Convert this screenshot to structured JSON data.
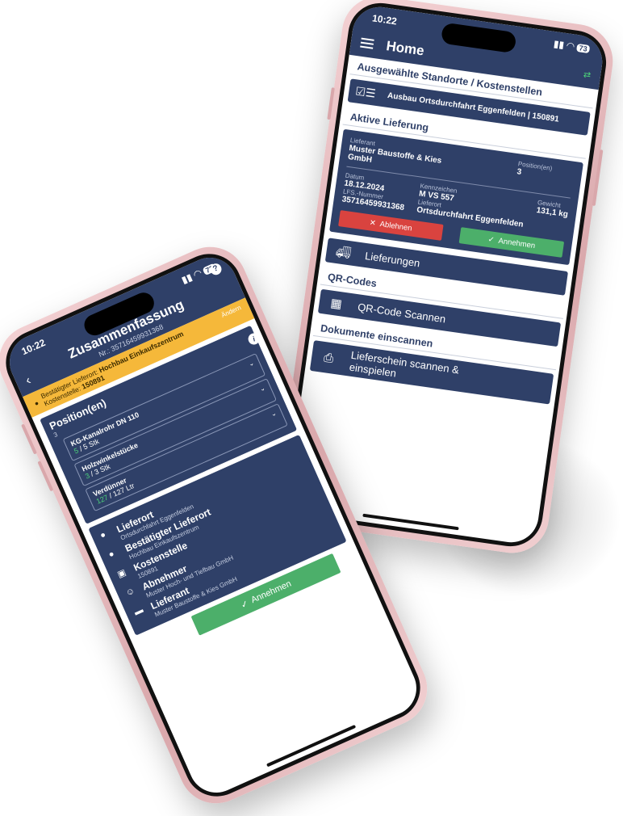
{
  "right_phone": {
    "status": {
      "time": "10:22",
      "battery": "73"
    },
    "appbar": {
      "title": "Home"
    },
    "sections": {
      "standorte": "Ausgewählte Standorte / Kostenstellen",
      "aktive": "Aktive Lieferung",
      "qr": "QR-Codes",
      "dokumente": "Dokumente einscannen"
    },
    "standort_item": "Ausbau Ortsdurchfahrt Eggenfelden | 150891",
    "delivery": {
      "lieferant_label": "Lieferant",
      "lieferant": "Muster Baustoffe & Kies GmbH",
      "positionen_label": "Position(en)",
      "positionen": "3",
      "datum_label": "Datum",
      "datum": "18.12.2024",
      "kennzeichen_label": "Kennzeichen",
      "kennzeichen": "M VS 557",
      "gewicht_label": "Gewicht",
      "gewicht": "131,1 kg",
      "lfs_label": "LFS.-Nummer",
      "lfs": "35716459931368",
      "lieferort_label": "Lieferort",
      "lieferort": "Ortsdurchfahrt Eggenfelden",
      "ablehnen": "Ablehnen",
      "annehmen": "Annehmen"
    },
    "buttons": {
      "lieferungen": "Lieferungen",
      "qr_scan": "QR-Code Scannen",
      "lieferschein": "Lieferschein scannen & einspielen"
    }
  },
  "left_phone": {
    "status": {
      "time": "10:22",
      "battery": "73"
    },
    "header": {
      "title": "Zusammenfassung",
      "subtitle": "Nr.: 35716459931368"
    },
    "banner": {
      "best_label": "Bestätigter Lieferort:",
      "best_value": "Hochbau Einkaufszentrum",
      "kst_label": "Kostenstelle:",
      "kst_value": "150891",
      "aendern": "Ändern"
    },
    "positions": {
      "title": "Position(en)",
      "count": "3",
      "items": [
        {
          "name": "KG-Kanalrohr DN 110",
          "done": "5",
          "total": "5 Stk"
        },
        {
          "name": "Holzwinkelstücke",
          "done": "3",
          "total": "3 Stk"
        },
        {
          "name": "Verdünner",
          "done": "127",
          "total": "127 Ltr"
        }
      ]
    },
    "details": [
      {
        "icon": "location-pin-icon",
        "title": "Lieferort",
        "value": "Ortsdurchfahrt Eggenfelden"
      },
      {
        "icon": "location-pin-icon",
        "title": "Bestätigter Lieferort",
        "value": "Hochbau Einkaufszentrum"
      },
      {
        "icon": "wallet-icon",
        "title": "Kostenstelle",
        "value": "150891"
      },
      {
        "icon": "person-icon",
        "title": "Abnehmer",
        "value": "Muster Hoch- und Tiefbau GmbH"
      },
      {
        "icon": "truck-icon",
        "title": "Lieferant",
        "value": "Muster Baustoffe & Kies GmbH"
      }
    ],
    "annehmen": "Annehmen"
  }
}
